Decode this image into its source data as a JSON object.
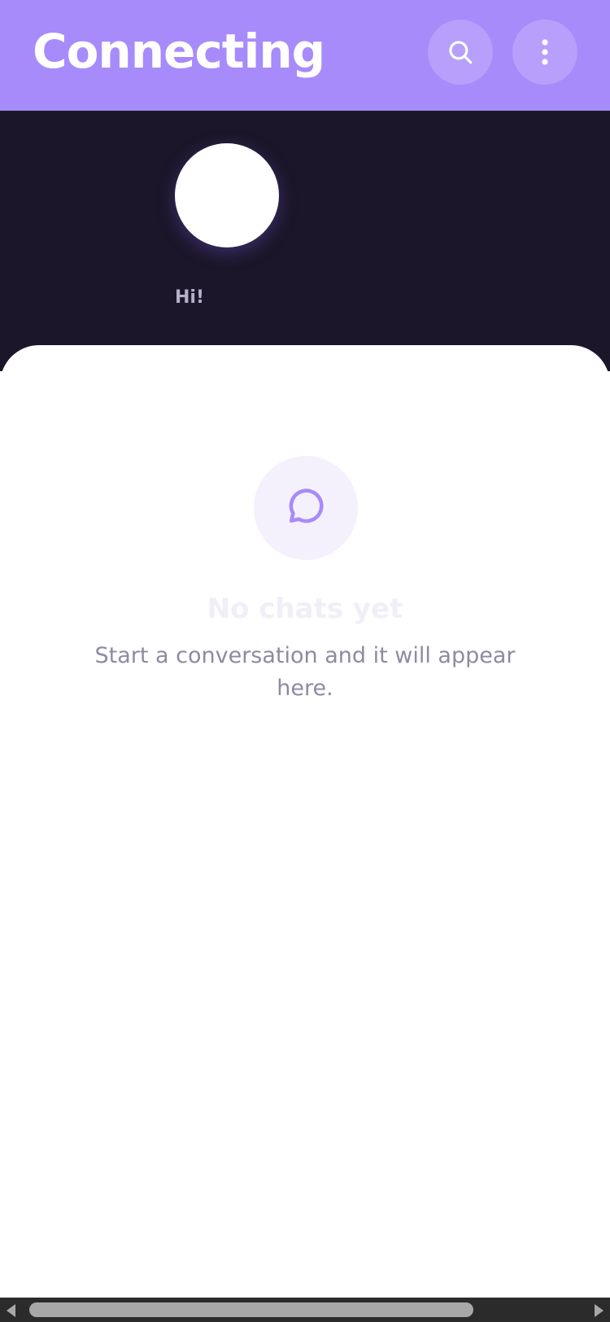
{
  "header": {
    "title": "Connecting",
    "background_color": "#a78bfa",
    "actions": [
      {
        "icon": "search-icon"
      },
      {
        "icon": "more-vertical-icon"
      }
    ]
  },
  "stories": {
    "background_color": "#1b1629",
    "items": [
      {
        "label": "Hi!"
      }
    ]
  },
  "empty_state": {
    "icon": "chat-bubble-icon",
    "title": "No chats yet",
    "subtitle": "Start a conversation and it will appear here.",
    "accent_color": "#a78bfa"
  },
  "scrollbar": {
    "orientation": "horizontal"
  }
}
